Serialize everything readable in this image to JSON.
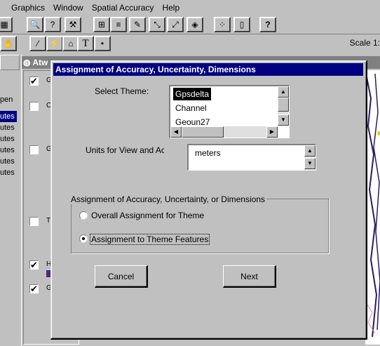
{
  "menubar": {
    "items": [
      "Graphics",
      "Window",
      "Spatial Accuracy",
      "Help"
    ]
  },
  "toolbar": {
    "help_button_label": "?"
  },
  "tools": {
    "text_tool_label": "T"
  },
  "scale": {
    "label": "Scale 1:"
  },
  "project_window": {
    "open_label": "pen",
    "rows": [
      "utes",
      "utes",
      "utes",
      "utes",
      "utes",
      "utes"
    ]
  },
  "view_window": {
    "title": "Atw",
    "toc": [
      "Gp",
      "Ch",
      "Ge",
      "Ti",
      "Hy",
      "Ge"
    ]
  },
  "dialog": {
    "title": "Assignment of Accuracy, Uncertainty, Dimensions",
    "select_theme_label": "Select Theme:",
    "themes": [
      "Gpsdelta",
      "Channel",
      "Geoun27"
    ],
    "selected_theme": "Gpsdelta",
    "units_label": "Units for View and Acc",
    "units": [
      "meters"
    ],
    "group_label": "Assignment of Accuracy, Uncertainty, or Dimensions",
    "options": [
      "Overall Assignment for Theme",
      "Assignment to Theme Features"
    ],
    "selected_option": "Assignment to Theme Features",
    "cancel_label": "Cancel",
    "next_label": "Next"
  },
  "colors": {
    "title_active": "#000080",
    "title_inactive": "#808080",
    "face": "#c0c0c0"
  }
}
